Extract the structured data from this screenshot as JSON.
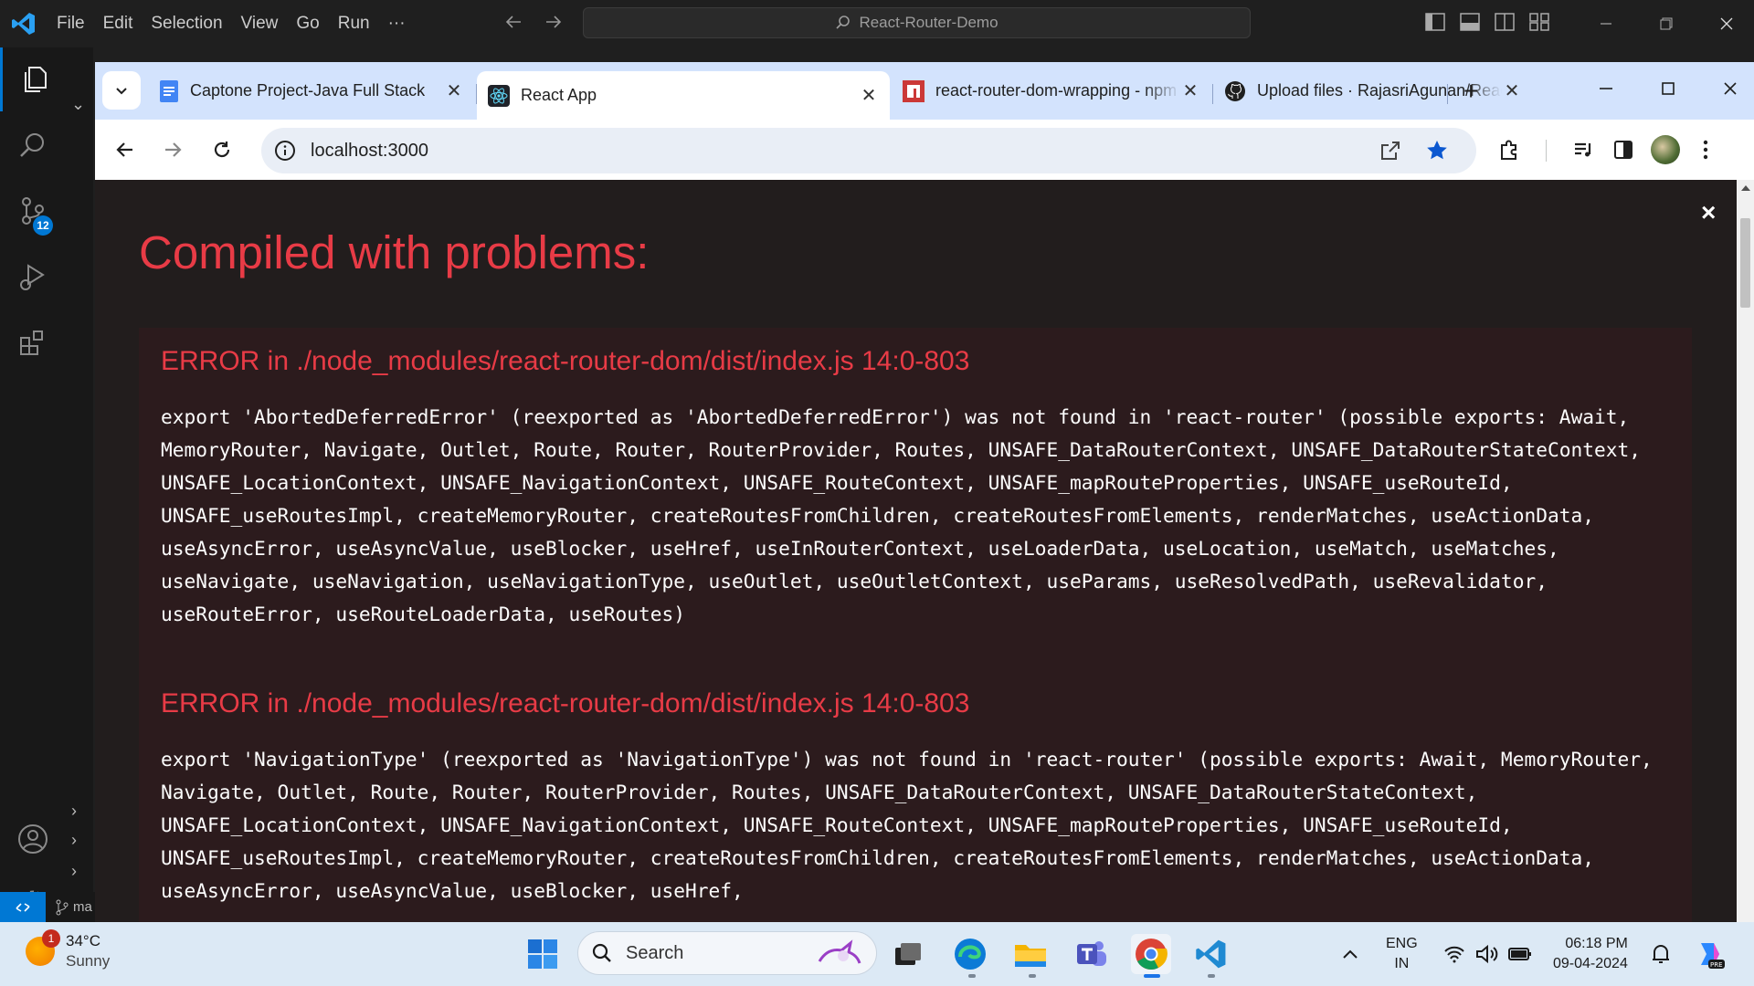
{
  "vscode": {
    "menu": [
      "File",
      "Edit",
      "Selection",
      "View",
      "Go",
      "Run",
      "···"
    ],
    "search_text": "React-Router-Demo",
    "scm_badge": "12",
    "status_branch": "ma"
  },
  "chrome": {
    "tabs": [
      {
        "title": "Captone Project-Java Full Stack",
        "icon": "google-docs-icon",
        "color": "#4285f4"
      },
      {
        "title": "React App",
        "icon": "react-icon",
        "color": "#0b6bb4"
      },
      {
        "title": "react-router-dom-wrapping - npm",
        "icon": "npm-icon",
        "color": "#cb3837"
      },
      {
        "title": "Upload files · RajasriAgunan/React",
        "icon": "github-icon",
        "color": "#1f1f1f"
      }
    ],
    "new_tab": "+",
    "url": "localhost:3000"
  },
  "overlay": {
    "title": "Compiled with problems:",
    "close": "×",
    "errors": [
      {
        "heading": "ERROR in ./node_modules/react-router-dom/dist/index.js 14:0-803",
        "message": "export 'AbortedDeferredError' (reexported as 'AbortedDeferredError') was not found in 'react-router' (possible exports: Await, MemoryRouter, Navigate, Outlet, Route, Router, RouterProvider, Routes, UNSAFE_DataRouterContext, UNSAFE_DataRouterStateContext, UNSAFE_LocationContext, UNSAFE_NavigationContext, UNSAFE_RouteContext, UNSAFE_mapRouteProperties, UNSAFE_useRouteId, UNSAFE_useRoutesImpl, createMemoryRouter, createRoutesFromChildren, createRoutesFromElements, renderMatches, useActionData, useAsyncError, useAsyncValue, useBlocker, useHref, useInRouterContext, useLoaderData, useLocation, useMatch, useMatches, useNavigate, useNavigation, useNavigationType, useOutlet, useOutletContext, useParams, useResolvedPath, useRevalidator, useRouteError, useRouteLoaderData, useRoutes)"
      },
      {
        "heading": "ERROR in ./node_modules/react-router-dom/dist/index.js 14:0-803",
        "message": "export 'NavigationType' (reexported as 'NavigationType') was not found in 'react-router' (possible exports: Await, MemoryRouter, Navigate, Outlet, Route, Router, RouterProvider, Routes, UNSAFE_DataRouterContext, UNSAFE_DataRouterStateContext, UNSAFE_LocationContext, UNSAFE_NavigationContext, UNSAFE_RouteContext, UNSAFE_mapRouteProperties, UNSAFE_useRouteId, UNSAFE_useRoutesImpl, createMemoryRouter, createRoutesFromChildren, createRoutesFromElements, renderMatches, useActionData, useAsyncError, useAsyncValue, useBlocker, useHref,"
      }
    ]
  },
  "taskbar": {
    "weather_temp": "34°C",
    "weather_cond": "Sunny",
    "weather_notif": "1",
    "search_placeholder": "Search",
    "lang_top": "ENG",
    "lang_bottom": "IN",
    "time": "06:18 PM",
    "date": "09-04-2024"
  },
  "colors": {
    "error_red": "#e83b46",
    "overlay_bg": "#221d1d",
    "error_box_bg": "#2c1b1d",
    "tab_strip": "#d3e3fd",
    "vscode_accent": "#0078d4"
  }
}
